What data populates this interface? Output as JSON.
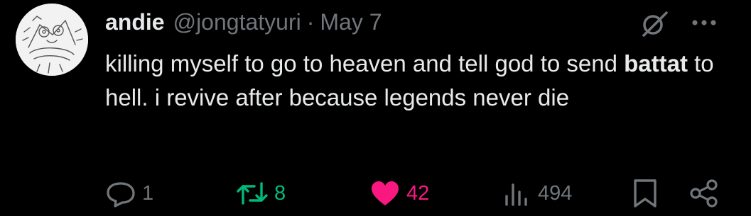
{
  "author": {
    "display_name": "andie",
    "handle": "@jongtatyuri",
    "separator": "·",
    "date": "May 7"
  },
  "tweet": {
    "text_before": "killing myself to go to heaven and tell god to send ",
    "text_bold": "battat",
    "text_after": " to hell. i revive after because legends never die"
  },
  "metrics": {
    "replies": "1",
    "retweets": "8",
    "likes": "42",
    "views": "494"
  },
  "icons": {
    "avatar": "avatar-sketch",
    "grok": "grok-icon",
    "more": "more-icon",
    "reply": "reply-icon",
    "retweet": "retweet-icon",
    "like": "heart-icon",
    "views": "views-icon",
    "bookmark": "bookmark-icon",
    "share": "share-icon"
  },
  "colors": {
    "background": "#000000",
    "text": "#e7e9ea",
    "muted": "#71767b",
    "retweet": "#00ba7c",
    "like": "#f91880"
  }
}
